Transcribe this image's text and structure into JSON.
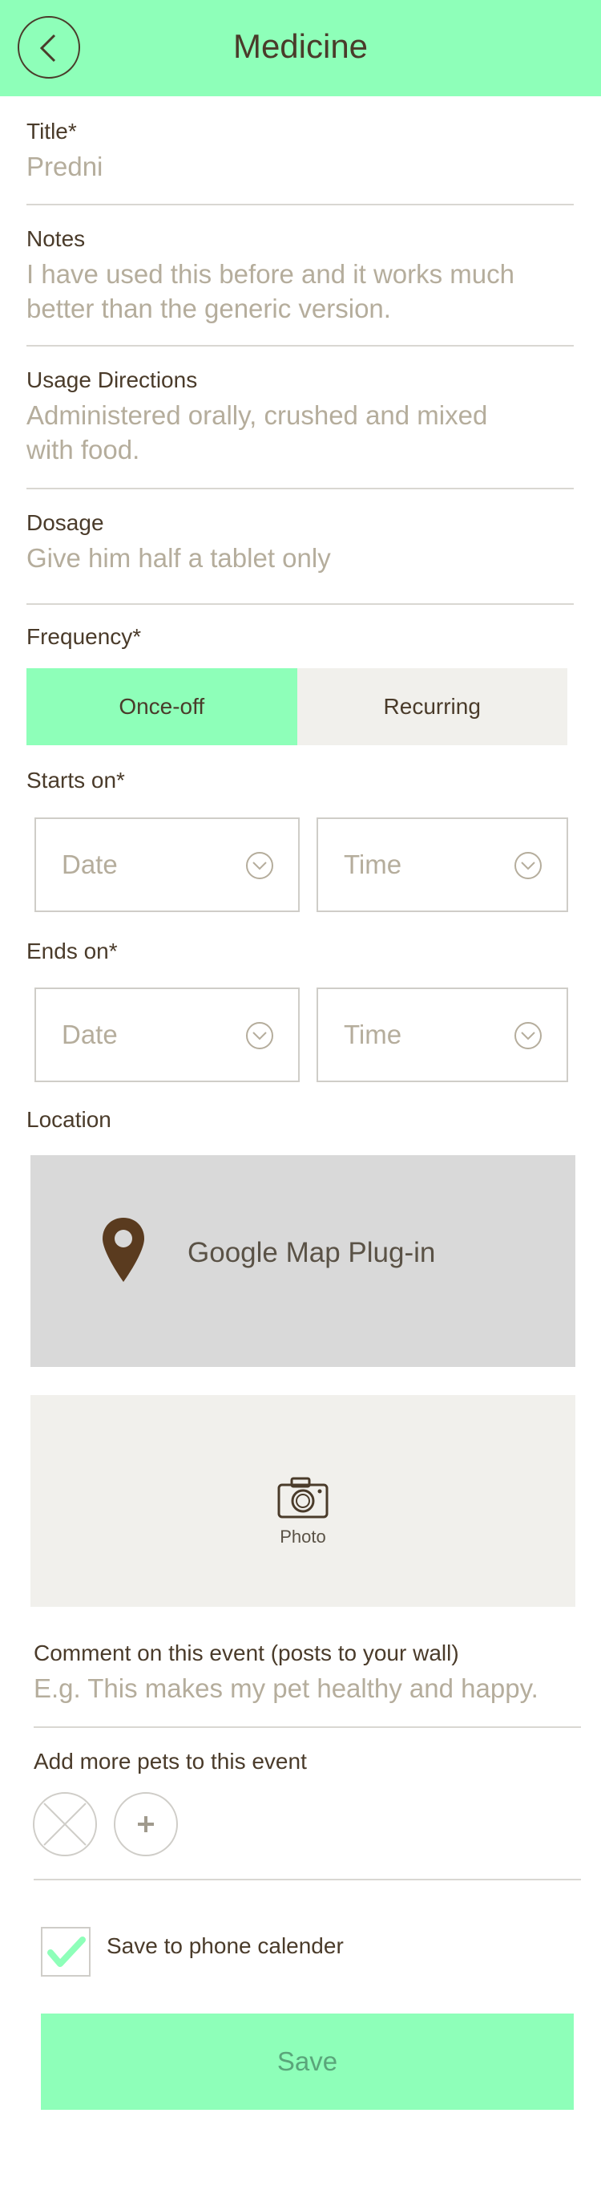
{
  "header": {
    "title": "Medicine",
    "back_icon": "chevron-left-icon",
    "color": "#8effb9"
  },
  "form": {
    "title": {
      "label": "Title*",
      "value": "Predni"
    },
    "notes": {
      "label": "Notes",
      "value": "I have used this before and it works much better than the generic version."
    },
    "usage": {
      "label": "Usage Directions",
      "value": "Administered orally, crushed and mixed with food."
    },
    "dosage": {
      "label": "Dosage",
      "value": "Give him half a tablet only"
    },
    "frequency": {
      "label": "Frequency*",
      "options": [
        "Once-off",
        "Recurring"
      ],
      "selected": "Once-off"
    },
    "starts_on": {
      "label": "Starts on*",
      "date_placeholder": "Date",
      "time_placeholder": "Time"
    },
    "ends_on": {
      "label": "Ends on*",
      "date_placeholder": "Date",
      "time_placeholder": "Time"
    },
    "location": {
      "label": "Location",
      "map_text": "Google Map Plug-in",
      "map_icon": "map-pin-icon"
    },
    "photo": {
      "label": "Photo",
      "icon": "camera-icon"
    },
    "comment": {
      "label": "Comment on this event (posts to your wall)",
      "placeholder": "E.g. This makes my pet healthy and happy."
    },
    "pets": {
      "label": "Add more pets to this event"
    },
    "calendar": {
      "label": "Save to phone calender",
      "checked": true
    },
    "save_label": "Save"
  },
  "colors": {
    "accent": "#8effb9",
    "text": "#4a3b2a",
    "placeholder": "#b5ad9c",
    "panel": "#f1f0ec",
    "map": "#d9d9d9"
  }
}
